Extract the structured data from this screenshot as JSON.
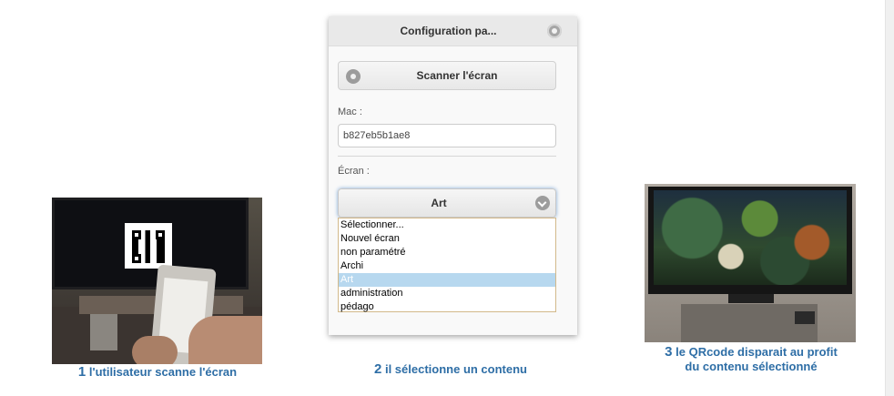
{
  "panel": {
    "title": "Configuration pa...",
    "scan_label": "Scanner l'écran",
    "mac_label": "Mac :",
    "mac_value": "b827eb5b1ae8",
    "ecran_label": "Écran :",
    "selected_value": "Art",
    "options": [
      "Sélectionner...",
      "Nouvel écran",
      "non paramétré",
      "Archi",
      "Art",
      "administration",
      "pédago"
    ],
    "selected_index": 4
  },
  "captions": {
    "step1_num": "1",
    "step1_text": "l'utilisateur scanne l'écran",
    "step2_num": "2",
    "step2_text": "il sélectionne un contenu",
    "step3_num": "3",
    "step3_line1": "le QRcode disparait au profit",
    "step3_line2": "du contenu sélectionné"
  },
  "colors": {
    "caption": "#2e6ea6",
    "selected_option": "#b7d8ef",
    "focus_glow": "#7fa9d8"
  },
  "icons": [
    "gear-icon",
    "camera-icon",
    "chevron-down-icon"
  ]
}
